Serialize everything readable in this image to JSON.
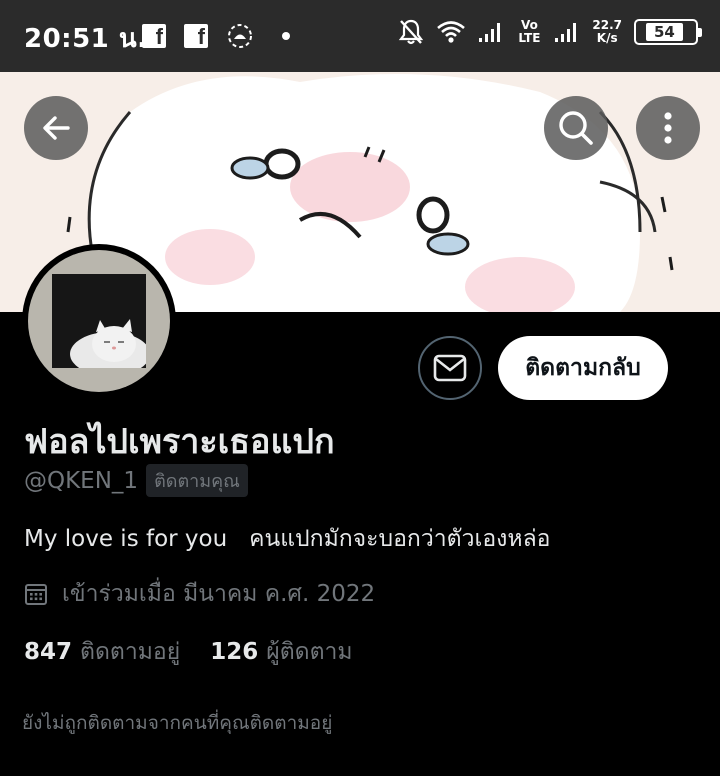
{
  "status_bar": {
    "time": "20:51 น.",
    "speed_value": "22.7",
    "speed_unit": "K/s",
    "network_label": "Vo LTE",
    "battery": "54"
  },
  "navigation": {
    "back_icon": "arrow-left-icon",
    "search_icon": "search-icon",
    "more_icon": "more-vertical-icon"
  },
  "profile": {
    "display_name": "ฟอลไปเพราะเธอแปก",
    "handle": "@QKEN_1",
    "follows_you_badge": "ติดตามคุณ",
    "bio": "My love is for you   คนแปกมักจะบอกว่าตัวเองหล่อ",
    "joined": "เข้าร่วมเมื่อ มีนาคม ค.ศ. 2022",
    "following_count": "847",
    "following_label": "ติดตามอยู่",
    "followers_count": "126",
    "followers_label": "ผู้ติดตาม",
    "not_followed_note": "ยังไม่ถูกติดตามจากคนที่คุณติดตามอยู่"
  },
  "actions": {
    "follow_back_label": "ติดตามกลับ",
    "message_icon": "mail-icon"
  },
  "colors": {
    "background": "#000000",
    "secondary_text": "#71767b",
    "status_bar": "#2b2b2b"
  }
}
